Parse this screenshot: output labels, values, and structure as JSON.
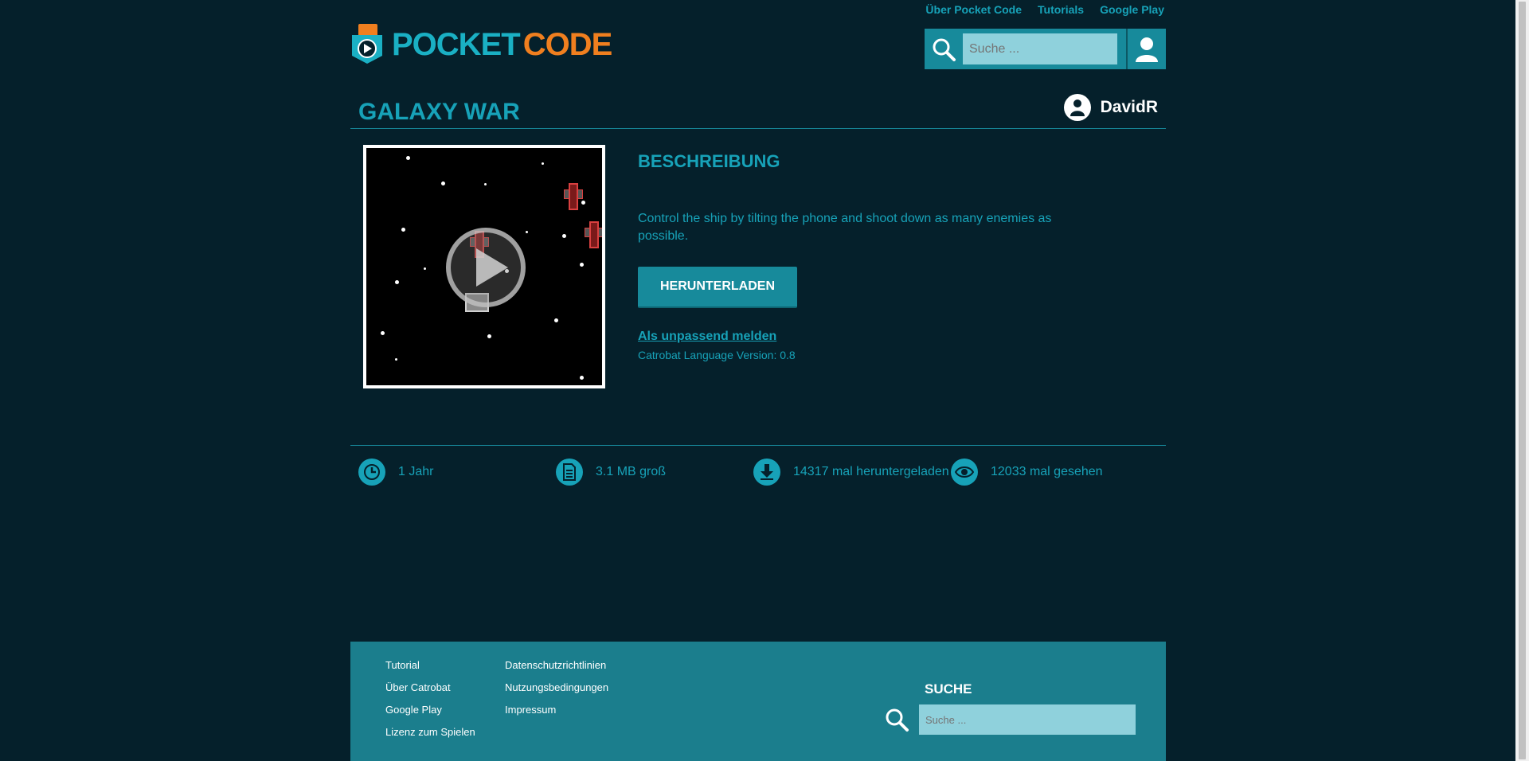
{
  "topnav": {
    "links": [
      {
        "label": "Über Pocket Code"
      },
      {
        "label": "Tutorials"
      },
      {
        "label": "Google Play"
      }
    ]
  },
  "brand": {
    "part1": "POCKET",
    "part2": "CODE",
    "colors": {
      "accent": "#1ab0c4",
      "orange": "#f07f1f"
    }
  },
  "header_search": {
    "placeholder": "Suche ..."
  },
  "program": {
    "title": "GALAXY WAR",
    "author": "DavidR",
    "description_heading": "BESCHREIBUNG",
    "description": "Control the ship by tilting the phone and shoot down as many enemies as possible.",
    "download_label": "HERUNTERLADEN",
    "report_label": "Als unpassend melden",
    "language_version": "Catrobat Language Version: 0.8"
  },
  "stats": [
    {
      "icon": "clock-icon",
      "text": "1 Jahr"
    },
    {
      "icon": "document-icon",
      "text": "3.1 MB groß"
    },
    {
      "icon": "download-icon",
      "text": "14317 mal heruntergeladen"
    },
    {
      "icon": "eye-icon",
      "text": "12033 mal gesehen"
    }
  ],
  "footer": {
    "col1": [
      "Tutorial",
      "Über Catrobat",
      "Google Play",
      "Lizenz zum Spielen"
    ],
    "col2": [
      "Datenschutzrichtlinien",
      "Nutzungsbedingungen",
      "Impressum"
    ],
    "search_heading": "SUCHE",
    "search_placeholder": "Suche ..."
  }
}
